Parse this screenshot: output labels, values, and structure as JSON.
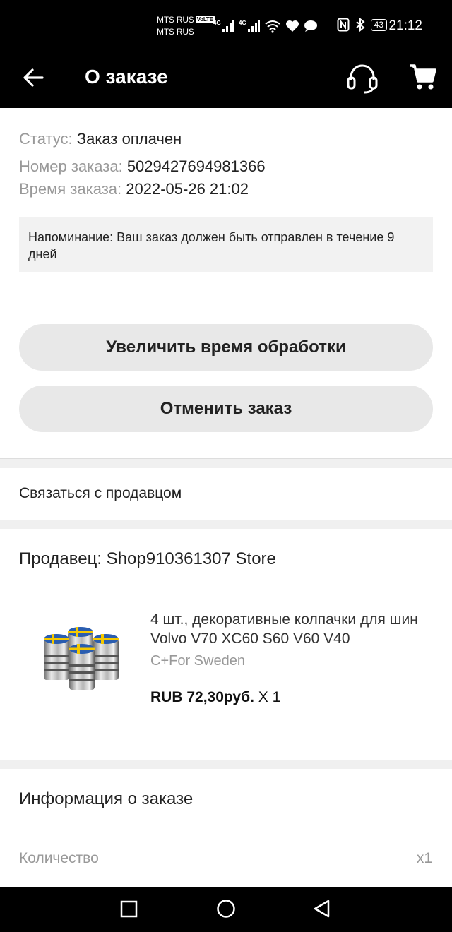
{
  "status_bar": {
    "carrier1": "MTS RUS",
    "volte": "VoLTE",
    "carrier2": "MTS RUS",
    "net1": "4G",
    "net2": "4G",
    "battery": "43",
    "time": "21:12"
  },
  "app_bar": {
    "title": "О заказе",
    "back_icon": "arrow-left-icon",
    "support_icon": "headset-icon",
    "cart_icon": "shopping-cart-icon"
  },
  "order": {
    "status_label": "Статус:",
    "status_value": "Заказ оплачен",
    "number_label": "Номер заказа:",
    "number_value": "5029427694981366",
    "time_label": "Время заказа:",
    "time_value": "2022-05-26 21:02",
    "reminder": "Напоминание: Ваш заказ должен быть отправлен в течение 9 дней"
  },
  "actions": {
    "extend": "Увеличить время обработки",
    "cancel": "Отменить заказ"
  },
  "contact_seller": "Связаться с продавцом",
  "seller": "Продавец: Shop910361307 Store",
  "product": {
    "title": "4 шт., декоративные колпачки для шин Volvo V70 XC60 S60 V60 V40",
    "variant": "C+For Sweden",
    "price": "RUB 72,30руб.",
    "qty": " X 1"
  },
  "order_info": {
    "title": "Информация о заказе",
    "quantity_label": "Количество",
    "quantity_value": "x1"
  },
  "colors": {
    "bar_bg": "#000000",
    "button_bg": "#e8e8e8",
    "muted_text": "#999999"
  }
}
